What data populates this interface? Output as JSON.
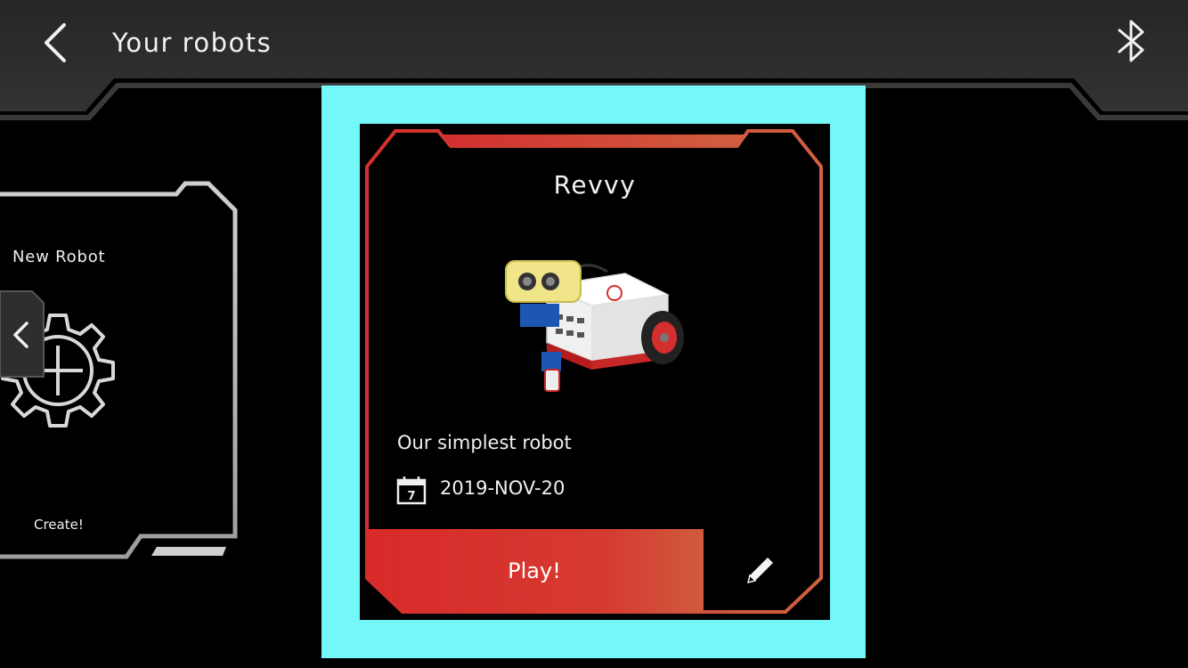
{
  "header": {
    "title": "Your robots",
    "back_icon": "chevron-left-icon",
    "bluetooth_icon": "bluetooth-icon",
    "background_color": "#2b2b2b"
  },
  "new_robot_card": {
    "title": "New Robot",
    "action_label": "Create!",
    "icon": "gear-plus-icon",
    "frame_color": "#c8c8c8"
  },
  "carousel": {
    "prev_icon": "chevron-left-icon"
  },
  "selected_robot": {
    "name": "Revvy",
    "description": "Our simplest robot",
    "date": "2019-NOV-20",
    "calendar_day": "7",
    "play_label": "Play!",
    "edit_icon": "pencil-icon",
    "highlight_color": "#74f7f8",
    "accent_color": "#d32f2f"
  }
}
